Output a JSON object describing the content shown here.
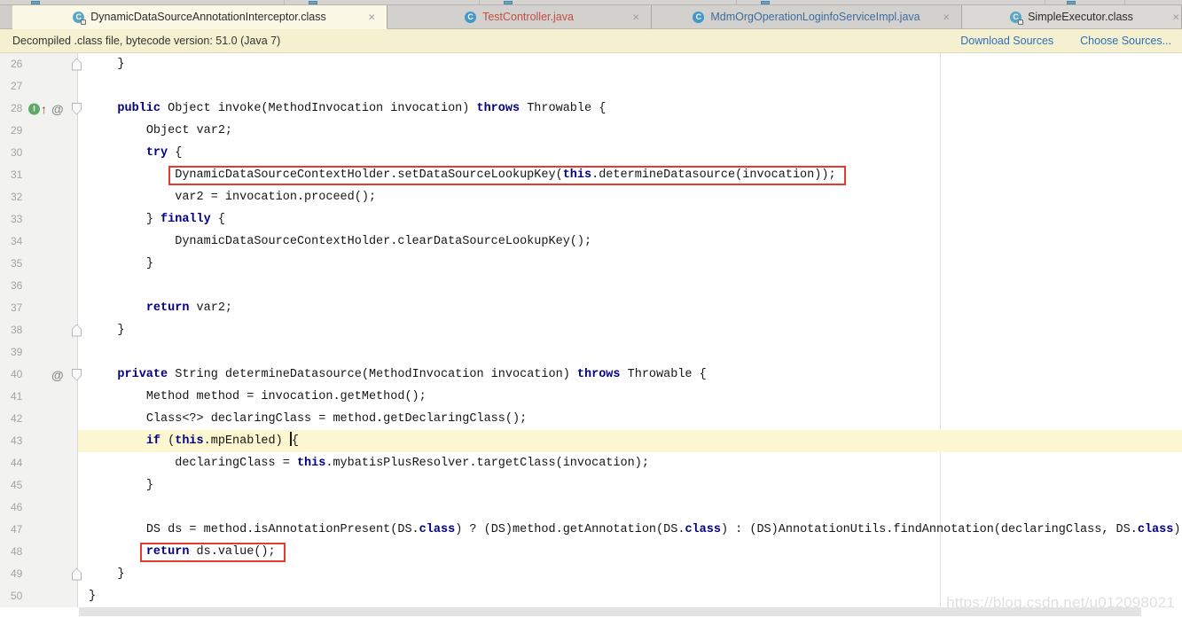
{
  "tab_bar": {
    "tabs": [
      {
        "label": "DynamicDataSourceAnnotationInterceptor.class",
        "icon": "class-locked",
        "state": "active",
        "text_color": "#2b2b2b"
      },
      {
        "label": "TestController.java",
        "icon": "java-file",
        "state": "inactive",
        "text_color": "#c24f44"
      },
      {
        "label": "MdmOrgOperationLoginfoServiceImpl.java",
        "icon": "java-file",
        "state": "inactive",
        "text_color": "#3e6c9e"
      },
      {
        "label": "SimpleExecutor.class",
        "icon": "class-locked",
        "state": "inactive2",
        "text_color": "#2b2b2b"
      }
    ],
    "close_glyph": "×"
  },
  "banner": {
    "message": "Decompiled .class file, bytecode version: 51.0 (Java 7)",
    "links": [
      {
        "label": "Download Sources"
      },
      {
        "label": "Choose Sources..."
      }
    ]
  },
  "glyphs": {
    "class_icon_letter": "C",
    "implementing_icon_letter": "I",
    "override_icon": "↑",
    "annotation_icon": "@"
  },
  "colors": {
    "keyword": "#000080",
    "highlight_box": "#e53b2c",
    "current_line_bg": "#fcf6d1",
    "link": "#2b6fb5",
    "banner_bg": "#f5f1d0",
    "active_tab_bg": "#fbf8e6"
  },
  "editor": {
    "lines": [
      {
        "no": 26,
        "indent": 1,
        "gutter": [
          "fold-up"
        ],
        "seg": [
          [
            "p",
            "}"
          ]
        ]
      },
      {
        "no": 27,
        "indent": 0,
        "seg": []
      },
      {
        "no": 28,
        "indent": 1,
        "gutter": [
          "impl",
          "override",
          "at",
          "fold-down"
        ],
        "seg": [
          [
            "k",
            "public"
          ],
          [
            "p",
            " Object invoke(MethodInvocation invocation) "
          ],
          [
            "k",
            "throws"
          ],
          [
            "p",
            " Throwable {"
          ]
        ]
      },
      {
        "no": 29,
        "indent": 2,
        "seg": [
          [
            "p",
            "Object var2;"
          ]
        ]
      },
      {
        "no": 30,
        "indent": 2,
        "seg": [
          [
            "k",
            "try"
          ],
          [
            "p",
            " {"
          ]
        ]
      },
      {
        "no": 31,
        "indent": 3,
        "box": true,
        "seg": [
          [
            "p",
            "DynamicDataSourceContextHolder.setDataSourceLookupKey("
          ],
          [
            "k",
            "this"
          ],
          [
            "p",
            ".determineDatasource(invocation));"
          ]
        ]
      },
      {
        "no": 32,
        "indent": 3,
        "seg": [
          [
            "p",
            "var2 = invocation.proceed();"
          ]
        ]
      },
      {
        "no": 33,
        "indent": 2,
        "seg": [
          [
            "p",
            "} "
          ],
          [
            "k",
            "finally"
          ],
          [
            "p",
            " {"
          ]
        ]
      },
      {
        "no": 34,
        "indent": 3,
        "seg": [
          [
            "p",
            "DynamicDataSourceContextHolder.clearDataSourceLookupKey();"
          ]
        ]
      },
      {
        "no": 35,
        "indent": 2,
        "seg": [
          [
            "p",
            "}"
          ]
        ]
      },
      {
        "no": 36,
        "indent": 0,
        "seg": []
      },
      {
        "no": 37,
        "indent": 2,
        "seg": [
          [
            "k",
            "return"
          ],
          [
            "p",
            " var2;"
          ]
        ]
      },
      {
        "no": 38,
        "indent": 1,
        "gutter": [
          "fold-up"
        ],
        "seg": [
          [
            "p",
            "}"
          ]
        ]
      },
      {
        "no": 39,
        "indent": 0,
        "seg": []
      },
      {
        "no": 40,
        "indent": 1,
        "gutter": [
          "at",
          "fold-down"
        ],
        "seg": [
          [
            "k",
            "private"
          ],
          [
            "p",
            " String determineDatasource(MethodInvocation invocation) "
          ],
          [
            "k",
            "throws"
          ],
          [
            "p",
            " Throwable {"
          ]
        ]
      },
      {
        "no": 41,
        "indent": 2,
        "seg": [
          [
            "p",
            "Method method = invocation.getMethod();"
          ]
        ]
      },
      {
        "no": 42,
        "indent": 2,
        "seg": [
          [
            "p",
            "Class<?> declaringClass = method.getDeclaringClass();"
          ]
        ]
      },
      {
        "no": 43,
        "indent": 2,
        "current": true,
        "seg": [
          [
            "k",
            "if"
          ],
          [
            "p",
            " ("
          ],
          [
            "k",
            "this"
          ],
          [
            "p",
            ".mpEnabled) "
          ],
          [
            "caret",
            ""
          ],
          [
            "p",
            "{"
          ]
        ]
      },
      {
        "no": 44,
        "indent": 3,
        "seg": [
          [
            "p",
            "declaringClass = "
          ],
          [
            "k",
            "this"
          ],
          [
            "p",
            ".mybatisPlusResolver.targetClass(invocation);"
          ]
        ]
      },
      {
        "no": 45,
        "indent": 2,
        "seg": [
          [
            "p",
            "}"
          ]
        ]
      },
      {
        "no": 46,
        "indent": 0,
        "seg": []
      },
      {
        "no": 47,
        "indent": 2,
        "seg": [
          [
            "p",
            "DS ds = method.isAnnotationPresent(DS."
          ],
          [
            "k",
            "class"
          ],
          [
            "p",
            ") ? (DS)method.getAnnotation(DS."
          ],
          [
            "k",
            "class"
          ],
          [
            "p",
            ") : (DS)AnnotationUtils.findAnnotation(declaringClass, DS."
          ],
          [
            "k",
            "class"
          ],
          [
            "p",
            ")"
          ]
        ]
      },
      {
        "no": 48,
        "indent": 2,
        "box": true,
        "seg": [
          [
            "k",
            "return"
          ],
          [
            "p",
            " ds.value();"
          ]
        ]
      },
      {
        "no": 49,
        "indent": 1,
        "gutter": [
          "fold-up"
        ],
        "seg": [
          [
            "p",
            "}"
          ]
        ]
      },
      {
        "no": 50,
        "indent": 0,
        "seg": [
          [
            "p",
            "}"
          ]
        ]
      }
    ]
  },
  "watermark": "https://blog.csdn.net/u012098021"
}
